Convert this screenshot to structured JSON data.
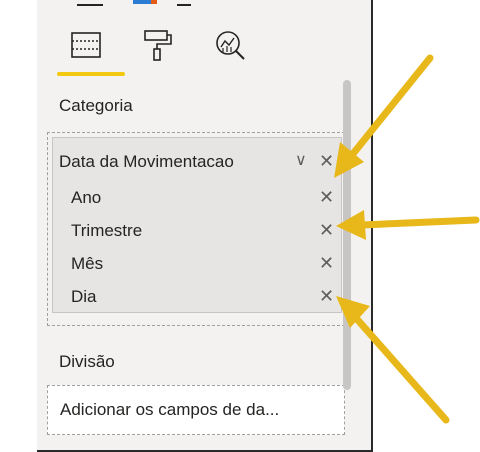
{
  "toolbar": {
    "icons": [
      "fields-icon",
      "format-paint-roller-icon",
      "analytics-magnifier-icon"
    ],
    "active_tab_color": "#f2c811"
  },
  "sections": {
    "category_label": "Categoria",
    "division_label": "Divisão",
    "division_placeholder": "Adicionar os campos de da..."
  },
  "hierarchy": {
    "field": "Data da Movimentacao",
    "levels": [
      "Ano",
      "Trimestre",
      "Mês",
      "Dia"
    ]
  },
  "annotation": {
    "arrow_color": "#e8b81a",
    "arrow_count": 3
  }
}
